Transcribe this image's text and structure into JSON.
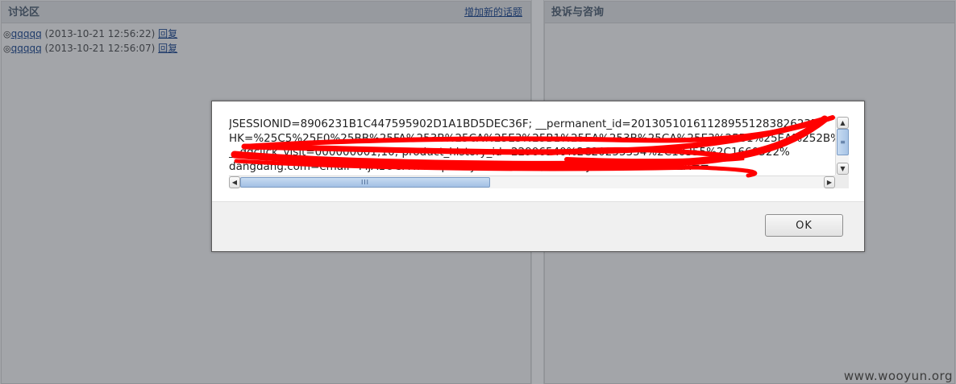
{
  "discussion": {
    "title": "讨论区",
    "add_topic_link": "增加新的话题",
    "posts": [
      {
        "bullet": "◎",
        "user": "qqqqq",
        "time": "(2013-10-21 12:56:22)",
        "reply": "回复"
      },
      {
        "bullet": "◎",
        "user": "qqqqq",
        "time": "(2013-10-21 12:56:07)",
        "reply": "回复"
      }
    ]
  },
  "complaints": {
    "title": "投诉与咨询"
  },
  "dialog": {
    "cookie_lines": [
      "JSESSIONID=8906231B1C447595902D1A1BD5DEC36F;  __permanent_id=201305101611289551283826237",
      "HK=%25C5%25E0%25BB%25FA%253B%25CA%25E3%25B1%25EA%253B%25CA%25E3%25B1%25EA%252B%",
      "__ddclick_visit=000000001;10; product_history_id=22906540%2C20255354%2C10355%2C1660522%",
      "dangdang.com=email=MjA1OGA4Mt9qMTMyMzNEBUFVQ44AA0hJeLEv=bGI0c2FuZA=="
    ],
    "ok_label": "OK"
  },
  "icons": {
    "scroll_up": "scroll-up-arrow",
    "scroll_down": "scroll-down-arrow",
    "scroll_left": "scroll-left-arrow",
    "scroll_right": "scroll-right-arrow"
  },
  "scroll": {
    "vertical_thumb_grip": "≡",
    "horizontal_thumb_grip": "III"
  },
  "colors": {
    "redaction": "#ff0000",
    "link": "#1f3b6a",
    "overlay_background": "#a4a6aa"
  },
  "watermark": "www.wooyun.org"
}
